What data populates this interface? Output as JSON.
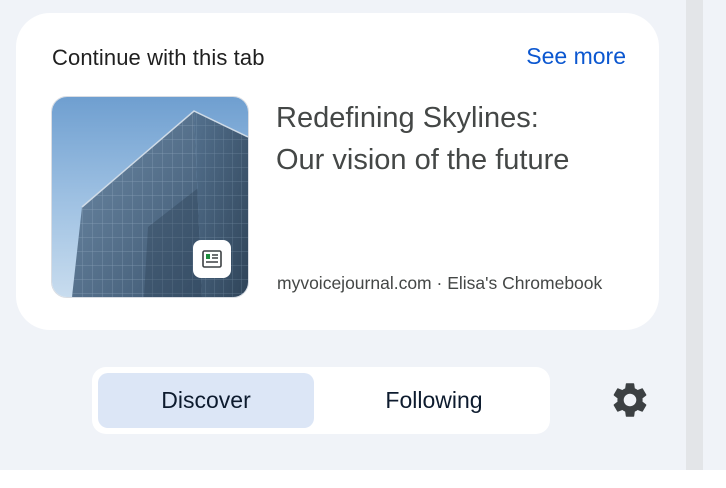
{
  "card": {
    "header": "Continue with this tab",
    "see_more": "See more",
    "tab_title_line1": "Redefining Skylines:",
    "tab_title_line2": "Our vision of the future",
    "tab_meta": "myvoicejournal.com · Elisa's Chromebook",
    "thumbnail_icon": "building-photo",
    "badge_icon": "article-icon"
  },
  "feed_tabs": {
    "items": [
      {
        "label": "Discover",
        "selected": true
      },
      {
        "label": "Following",
        "selected": false
      }
    ],
    "settings_icon": "gear-icon"
  },
  "colors": {
    "accent": "#0b57d0",
    "selected_tab_bg": "#dce6f6",
    "page_bg": "#f0f3f8",
    "card_bg": "#ffffff"
  }
}
